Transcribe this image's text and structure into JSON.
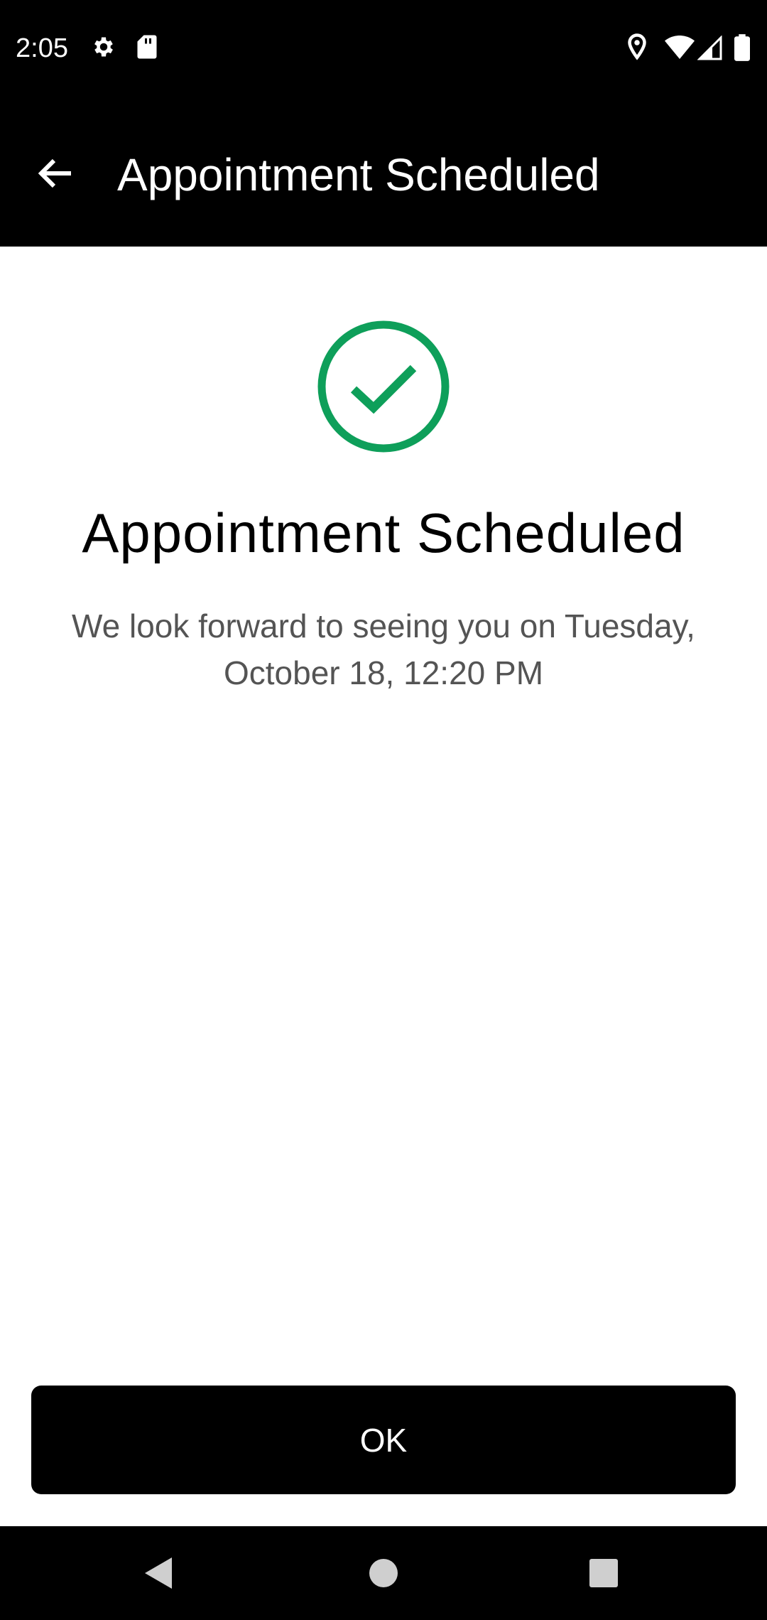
{
  "status_bar": {
    "time": "2:05",
    "icons": [
      "gear-icon",
      "sd-card-icon",
      "location-icon",
      "wifi-icon",
      "signal-icon",
      "battery-icon"
    ]
  },
  "app_bar": {
    "title": "Appointment Scheduled",
    "back_icon": "arrow-left-icon"
  },
  "content": {
    "icon": "check-circle-icon",
    "headline": "Appointment Scheduled",
    "message": "We look forward to seeing you on Tuesday, October 18, 12:20 PM"
  },
  "actions": {
    "ok_label": "OK"
  },
  "nav_bar": {
    "icons": [
      "nav-back-icon",
      "nav-home-icon",
      "nav-recents-icon"
    ]
  },
  "colors": {
    "accent_green": "#0E9F5A",
    "bar_background": "#000000",
    "message_text": "#545454"
  }
}
